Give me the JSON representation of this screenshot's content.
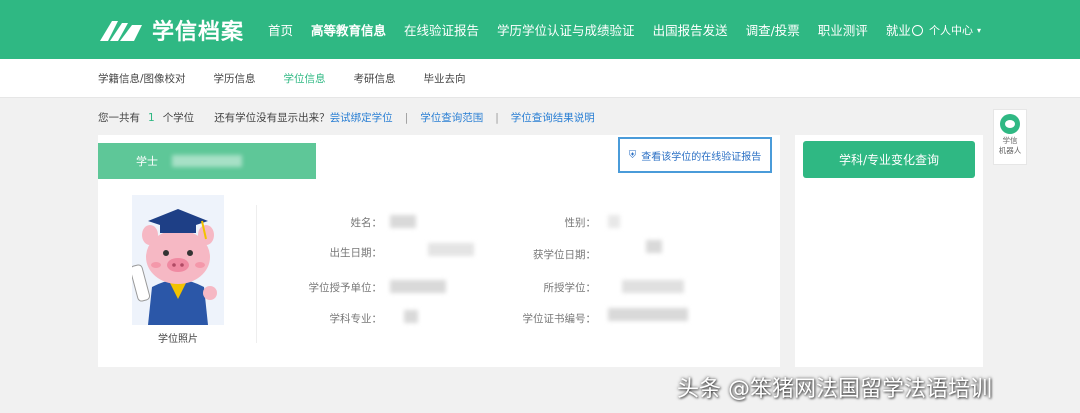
{
  "header": {
    "logo_text": "学信档案",
    "nav": [
      "首页",
      "高等教育信息",
      "在线验证报告",
      "学历学位认证与成绩验证",
      "出国报告发送",
      "调查/投票",
      "职业测评",
      "就业"
    ],
    "active_nav_index": 1,
    "user_center": "个人中心"
  },
  "subnav": {
    "items": [
      "学籍信息/图像校对",
      "学历信息",
      "学位信息",
      "考研信息",
      "毕业去向"
    ],
    "active_index": 2
  },
  "infoline": {
    "prefix": "您一共有",
    "count": "1",
    "suffix": "个学位",
    "question": "还有学位没有显示出来？",
    "link1": "尝试绑定学位",
    "sep1": "|",
    "link2": "学位查询范围",
    "sep2": "|",
    "link3": "学位查询结果说明"
  },
  "card": {
    "degree_label": "学士",
    "verify_button": "查看该学位的在线验证报告",
    "photo_caption": "学位照片",
    "fields": {
      "name": "姓名：",
      "gender": "性别：",
      "birth": "出生日期：",
      "degree_date": "获学位日期：",
      "unit": "学位授予单位：",
      "degree": "所授学位：",
      "major": "学科专业：",
      "cert_no": "学位证书编号："
    }
  },
  "side": {
    "button": "学科/专业变化查询"
  },
  "robot": {
    "line1": "学信",
    "line2": "机器人"
  },
  "watermark": "头条 @笨猪网法国留学法语培训",
  "colors": {
    "brand_green": "#2fb883",
    "link_blue": "#2a7fd4"
  }
}
